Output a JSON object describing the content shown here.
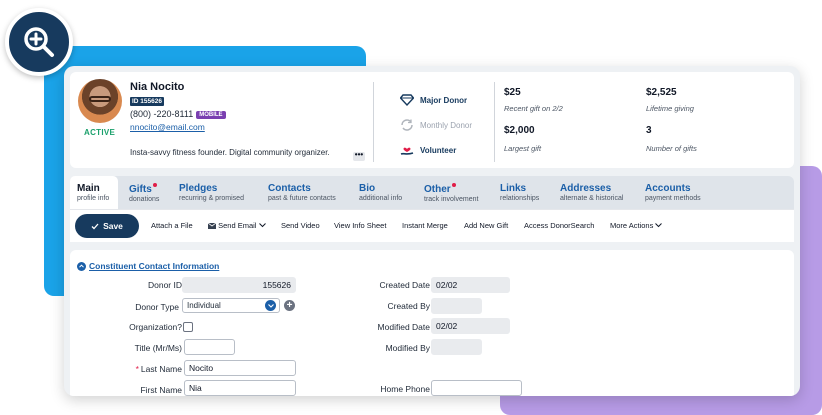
{
  "colors": {
    "brand_navy": "#173a5e",
    "link_blue": "#1b5fa8",
    "accent_cyan": "#1aa3e8",
    "accent_purple": "#b79be6",
    "active_green": "#1aa06b",
    "mobile_purple": "#7a3fb0"
  },
  "zoom": {
    "icon": "zoom-in-icon"
  },
  "profile": {
    "name": "Nia Nocito",
    "id_badge": "ID 155626",
    "phone": "(800) -220-8111",
    "phone_type": "MOBILE",
    "email": "nnocito@email.com",
    "bio": "Insta-savvy fitness founder. Digital community organizer.",
    "status": "ACTIVE",
    "more": "•••"
  },
  "badges": [
    {
      "label": "Major Donor",
      "icon": "diamond-icon",
      "muted": false
    },
    {
      "label": "Monthly Donor",
      "icon": "recurring-icon",
      "muted": true
    },
    {
      "label": "Volunteer",
      "icon": "hand-heart-icon",
      "muted": false
    }
  ],
  "stats": [
    {
      "value": "$25",
      "label": "Recent gift on 2/2"
    },
    {
      "value": "$2,525",
      "label": "Lifetime giving"
    },
    {
      "value": "$2,000",
      "label": "Largest gift"
    },
    {
      "value": "3",
      "label": "Number of gifts"
    }
  ],
  "tabs": [
    {
      "title": "Main",
      "sub": "profile info"
    },
    {
      "title": "Gifts",
      "sub": "donations"
    },
    {
      "title": "Pledges",
      "sub": "recurring & promised"
    },
    {
      "title": "Contacts",
      "sub": "past & future contacts"
    },
    {
      "title": "Bio",
      "sub": "additional info"
    },
    {
      "title": "Other",
      "sub": "track involvement"
    },
    {
      "title": "Links",
      "sub": "relationships"
    },
    {
      "title": "Addresses",
      "sub": "alternate & historical"
    },
    {
      "title": "Accounts",
      "sub": "payment methods"
    }
  ],
  "toolbar": {
    "save": "Save",
    "attach": "Attach a File",
    "send_email": "Send Email",
    "send_video": "Send Video",
    "view_info": "View Info Sheet",
    "instant_merge": "Instant Merge",
    "add_gift": "Add New Gift",
    "donorsearch": "Access DonorSearch",
    "more_actions": "More Actions"
  },
  "form": {
    "section_title": "Constituent Contact Information",
    "donor_id_label": "Donor ID",
    "donor_id_value": "155626",
    "donor_type_label": "Donor Type",
    "donor_type_value": "Individual",
    "organization_label": "Organization?",
    "title_label": "Title (Mr/Ms)",
    "title_value": "",
    "last_name_label": "Last Name",
    "last_name_value": "Nocito",
    "first_name_label": "First Name",
    "first_name_value": "Nia",
    "created_date_label": "Created Date",
    "created_date_value": "02/02",
    "created_by_label": "Created By",
    "created_by_value": "",
    "modified_date_label": "Modified Date",
    "modified_date_value": "02/02",
    "modified_by_label": "Modified By",
    "modified_by_value": "",
    "home_phone_label": "Home Phone",
    "home_phone_value": ""
  }
}
